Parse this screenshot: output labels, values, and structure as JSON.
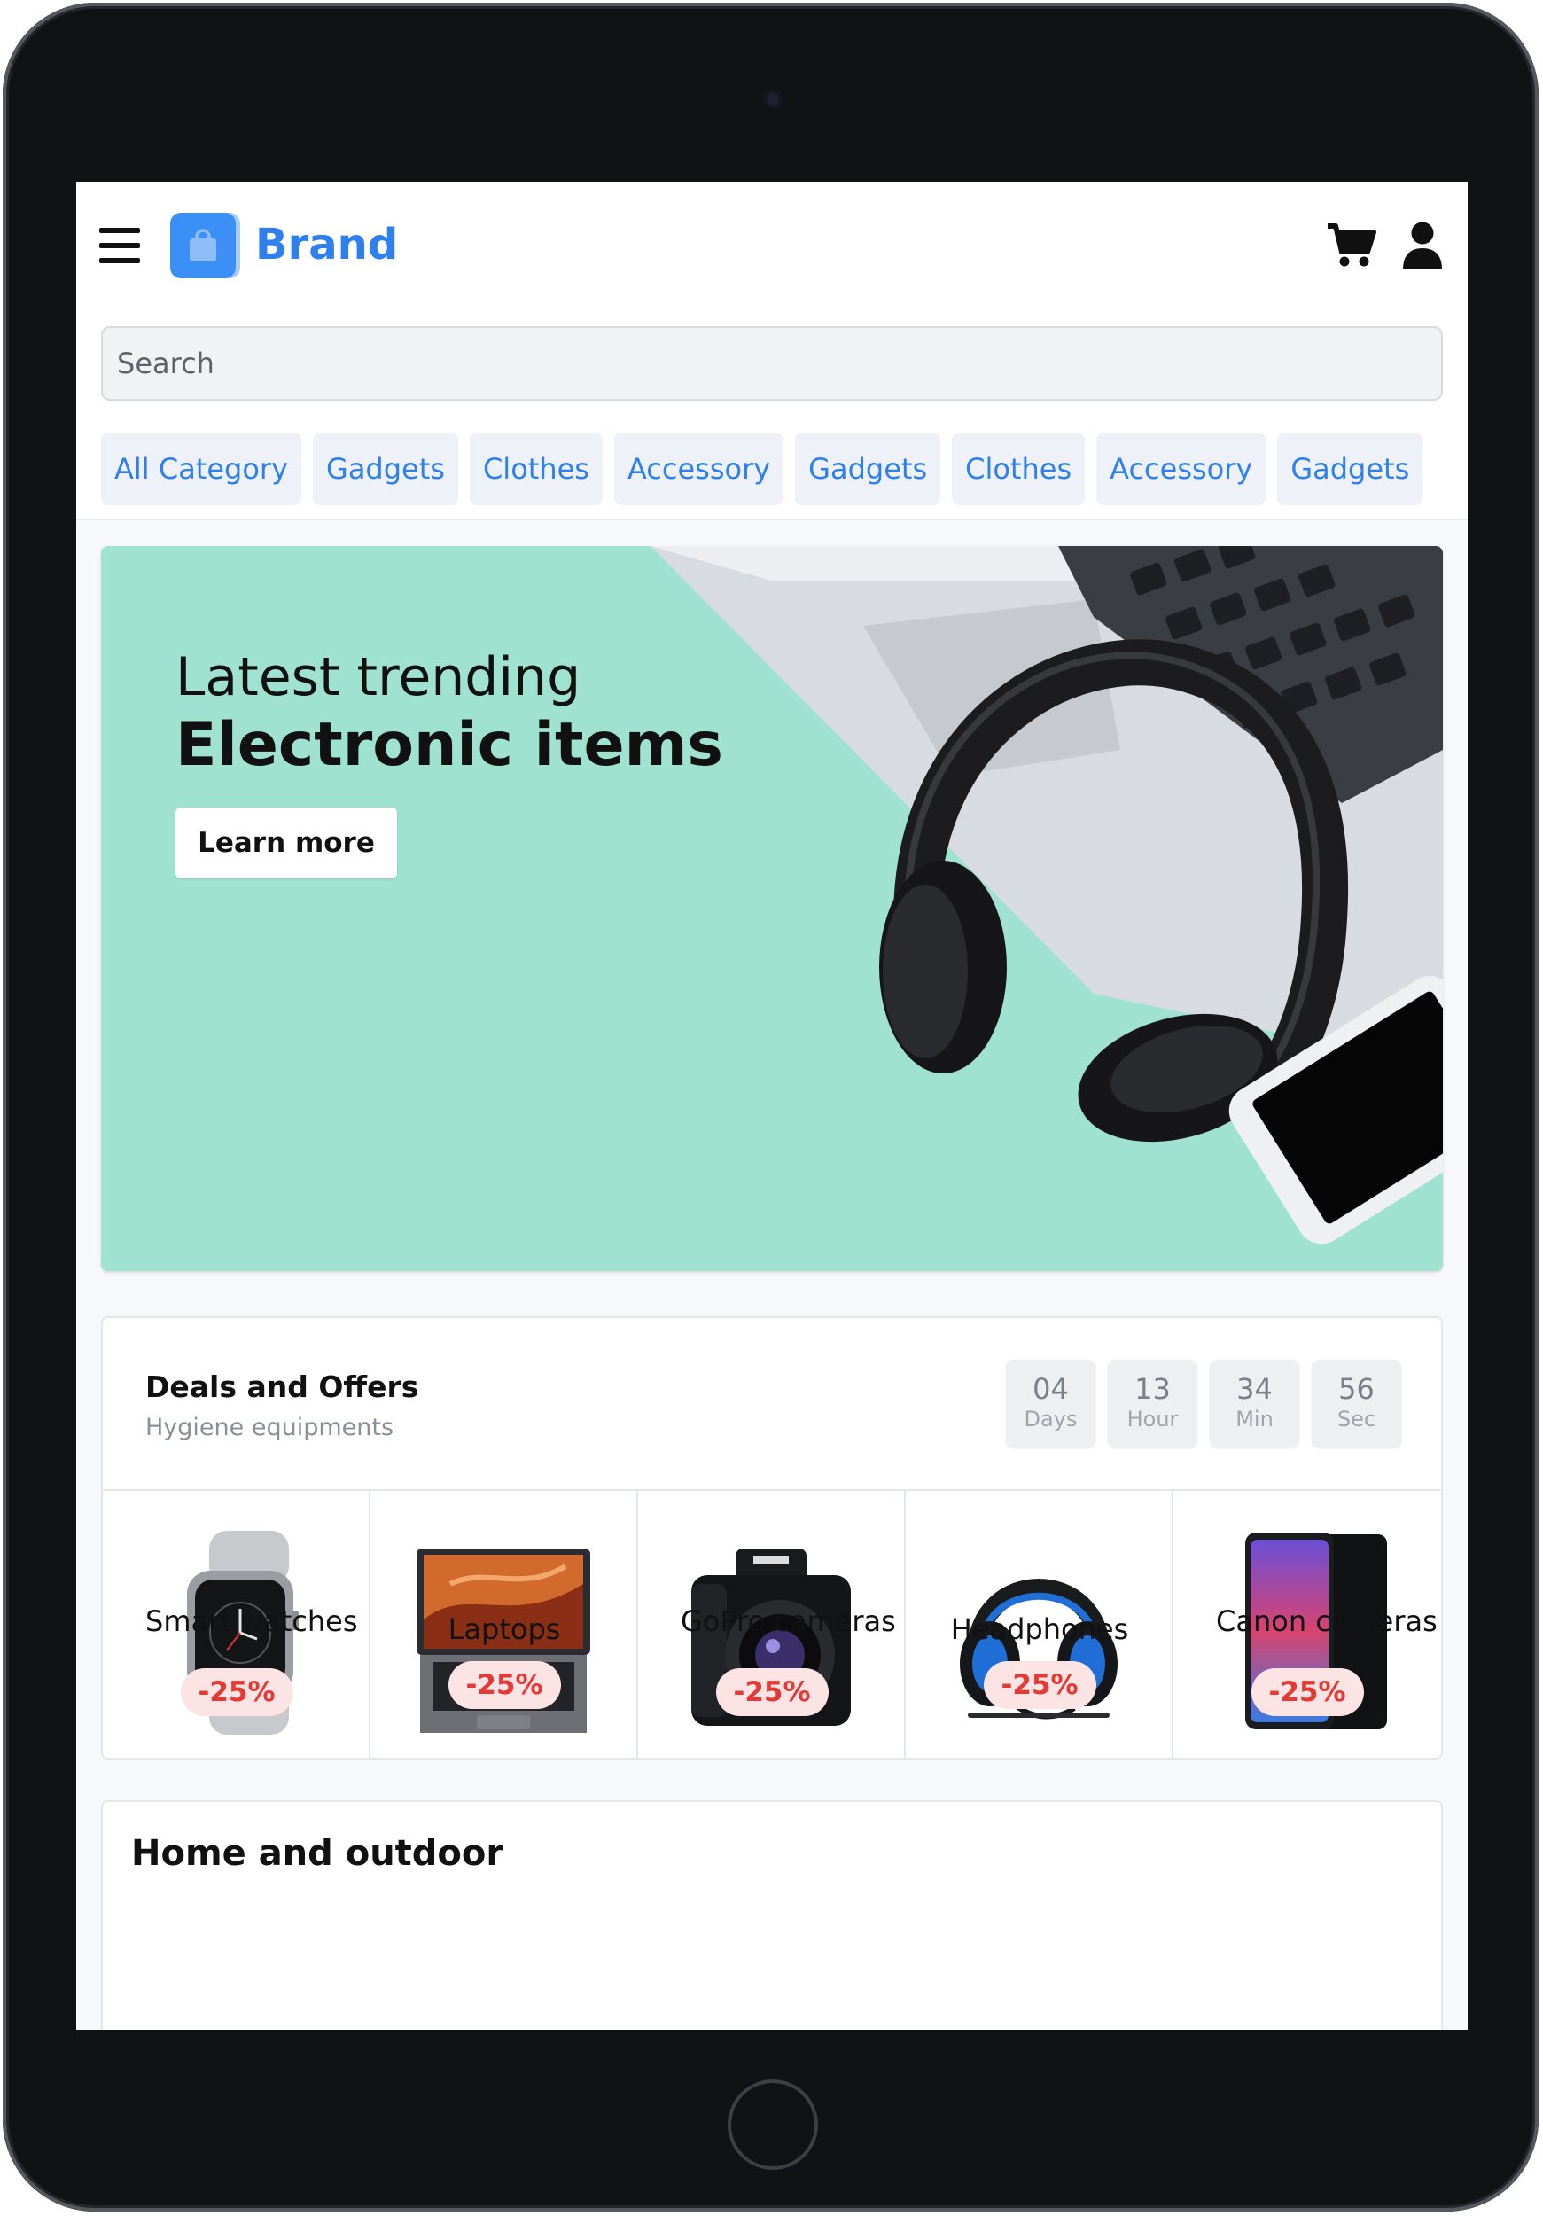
{
  "header": {
    "brand": "Brand",
    "search_placeholder": "Search",
    "categories": [
      "All Category",
      "Gadgets",
      "Clothes",
      "Accessory",
      "Gadgets",
      "Clothes",
      "Accessory",
      "Gadgets"
    ]
  },
  "hero": {
    "line1": "Latest trending",
    "line2": "Electronic items",
    "button_label": "Learn more"
  },
  "deals": {
    "title": "Deals and Offers",
    "subtitle": "Hygiene equipments",
    "timer": [
      {
        "value": "04",
        "unit": "Days"
      },
      {
        "value": "13",
        "unit": "Hour"
      },
      {
        "value": "34",
        "unit": "Min"
      },
      {
        "value": "56",
        "unit": "Sec"
      }
    ],
    "products": [
      {
        "name": "Smart watches",
        "discount": "-25%",
        "icon": "smartwatch-image"
      },
      {
        "name": "Laptops",
        "discount": "-25%",
        "icon": "laptop-image"
      },
      {
        "name": "GoPro cameras",
        "discount": "-25%",
        "icon": "camera-image"
      },
      {
        "name": "Headphones",
        "discount": "-25%",
        "icon": "headphones-image"
      },
      {
        "name": "Canon cameras",
        "discount": "-25%",
        "icon": "smartphone-image"
      }
    ]
  },
  "next_section": {
    "title": "Home and outdoor"
  },
  "colors": {
    "accent": "#2f80ed",
    "hero_bg": "#9ee2cf",
    "badge_bg": "#fde4e4",
    "badge_text": "#e53935"
  },
  "icons": {
    "menu": "hamburger-menu-icon",
    "logo": "shopping-bag-icon",
    "cart": "shopping-cart-icon",
    "user": "user-icon"
  }
}
